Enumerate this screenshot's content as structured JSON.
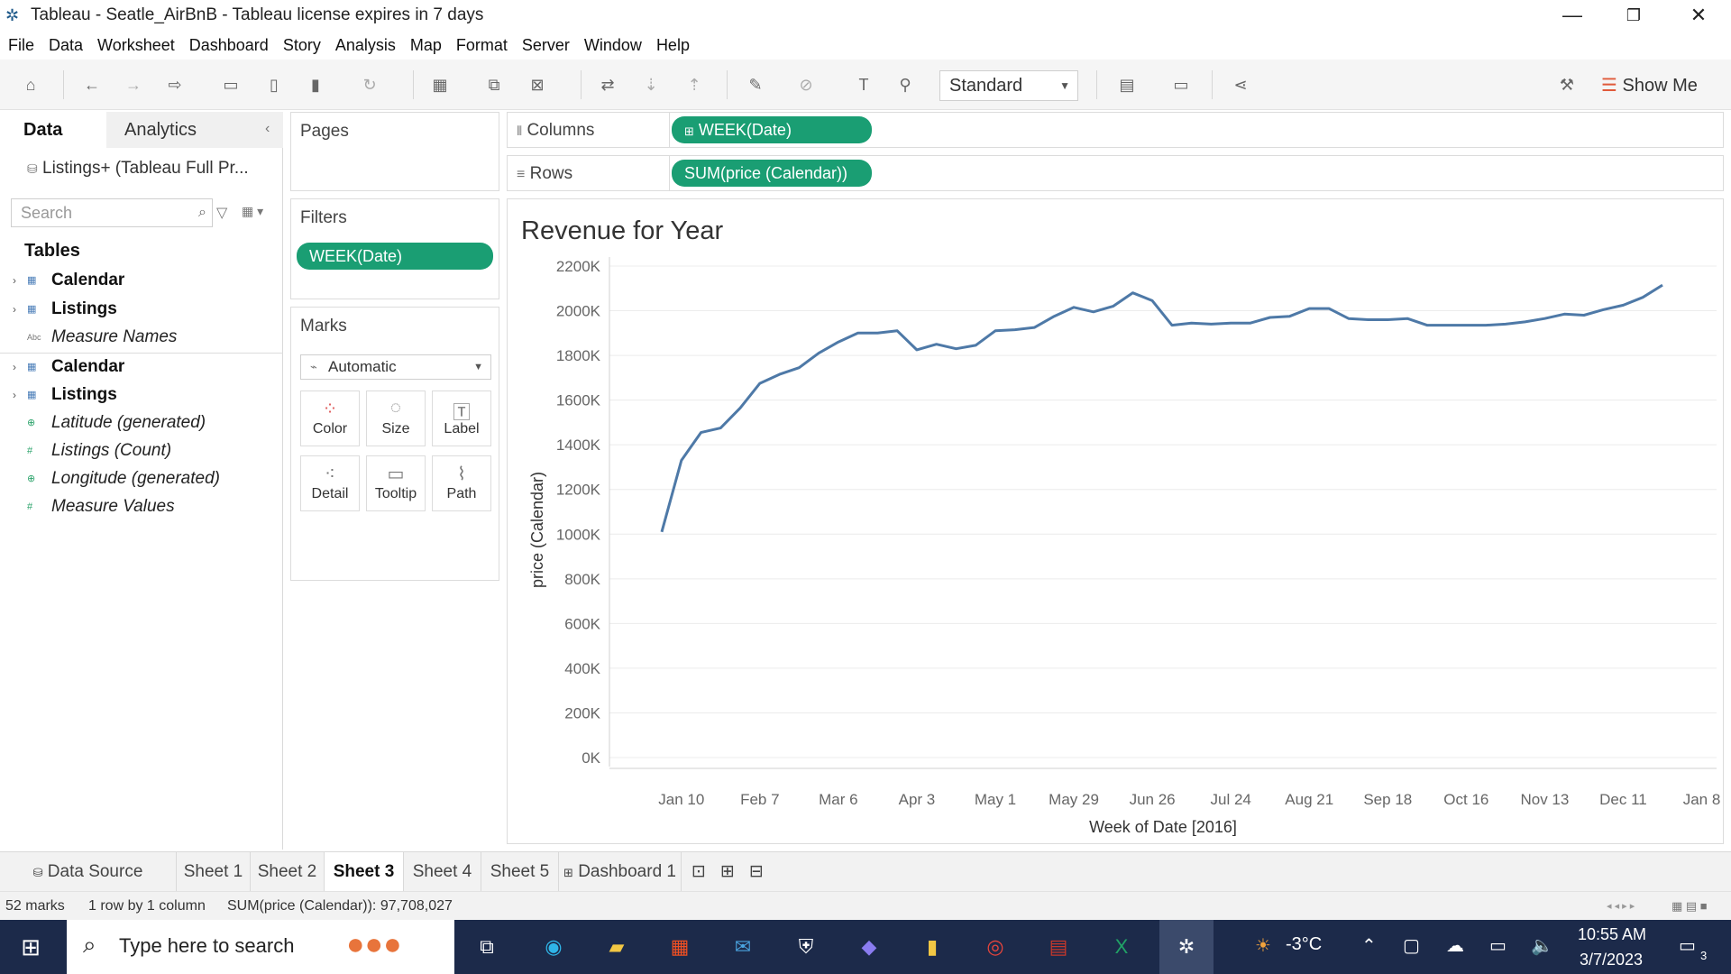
{
  "window": {
    "title": "Tableau - Seatle_AirBnB - Tableau license expires in 7 days",
    "icon": "tableau-logo-icon"
  },
  "menu": [
    "File",
    "Data",
    "Worksheet",
    "Dashboard",
    "Story",
    "Analysis",
    "Map",
    "Format",
    "Server",
    "Window",
    "Help"
  ],
  "toolbar": {
    "fit_select": "Standard",
    "show_me": "Show Me"
  },
  "data_pane": {
    "tab_data": "Data",
    "tab_analytics": "Analytics",
    "datasource": "Listings+ (Tableau Full Pr...",
    "search_placeholder": "Search",
    "tables_heading": "Tables",
    "fields": [
      {
        "label": "Calendar",
        "type": "table"
      },
      {
        "label": "Listings",
        "type": "table"
      },
      {
        "label": "Measure Names",
        "type": "abc"
      },
      {
        "label": "Calendar",
        "type": "table"
      },
      {
        "label": "Listings",
        "type": "table"
      },
      {
        "label": "Latitude (generated)",
        "type": "geo"
      },
      {
        "label": "Listings (Count)",
        "type": "measure"
      },
      {
        "label": "Longitude (generated)",
        "type": "geo"
      },
      {
        "label": "Measure Values",
        "type": "measure"
      }
    ]
  },
  "pages_card": {
    "title": "Pages"
  },
  "filters_card": {
    "title": "Filters",
    "pill": "WEEK(Date)"
  },
  "marks_card": {
    "title": "Marks",
    "type": "Automatic",
    "buttons": [
      "Color",
      "Size",
      "Label",
      "Detail",
      "Tooltip",
      "Path"
    ]
  },
  "shelves": {
    "columns_label": "Columns",
    "columns_pill": "WEEK(Date)",
    "rows_label": "Rows",
    "rows_pill": "SUM(price (Calendar))"
  },
  "viz": {
    "title": "Revenue for Year"
  },
  "chart_data": {
    "type": "line",
    "title": "Revenue for Year",
    "xlabel": "Week of Date [2016]",
    "ylabel": "price (Calendar)",
    "y_ticks": [
      "0K",
      "200K",
      "400K",
      "600K",
      "800K",
      "1000K",
      "1200K",
      "1400K",
      "1600K",
      "1800K",
      "2000K",
      "2200K"
    ],
    "x_ticks": [
      "Jan 10",
      "Feb 7",
      "Mar 6",
      "Apr 3",
      "May 1",
      "May 29",
      "Jun 26",
      "Jul 24",
      "Aug 21",
      "Sep 18",
      "Oct 16",
      "Nov 13",
      "Dec 11",
      "Jan 8"
    ],
    "ylim": [
      0,
      2200000
    ],
    "x": [
      "Jan 3",
      "Jan 10",
      "Jan 17",
      "Jan 24",
      "Jan 31",
      "Feb 7",
      "Feb 14",
      "Feb 21",
      "Feb 28",
      "Mar 6",
      "Mar 13",
      "Mar 20",
      "Mar 27",
      "Apr 3",
      "Apr 10",
      "Apr 17",
      "Apr 24",
      "May 1",
      "May 8",
      "May 15",
      "May 22",
      "May 29",
      "Jun 5",
      "Jun 12",
      "Jun 19",
      "Jun 26",
      "Jul 3",
      "Jul 10",
      "Jul 17",
      "Jul 24",
      "Jul 31",
      "Aug 7",
      "Aug 14",
      "Aug 21",
      "Aug 28",
      "Sep 4",
      "Sep 11",
      "Sep 18",
      "Sep 25",
      "Oct 2",
      "Oct 9",
      "Oct 16",
      "Oct 23",
      "Oct 30",
      "Nov 6",
      "Nov 13",
      "Nov 20",
      "Nov 27",
      "Dec 4",
      "Dec 11",
      "Dec 18",
      "Dec 25"
    ],
    "series": [
      {
        "values": [
          1010000,
          1330000,
          1455000,
          1475000,
          1565000,
          1675000,
          1715000,
          1745000,
          1810000,
          1860000,
          1900000,
          1900000,
          1910000,
          1825000,
          1850000,
          1830000,
          1845000,
          1910000,
          1915000,
          1925000,
          1975000,
          2015000,
          1995000,
          2020000,
          2080000,
          2045000,
          1935000,
          1945000,
          1940000,
          1945000,
          1945000,
          1970000,
          1975000,
          2010000,
          2010000,
          1965000,
          1960000,
          1960000,
          1965000,
          1935000,
          1935000,
          1935000,
          1935000,
          1940000,
          1950000,
          1965000,
          1985000,
          1980000,
          2005000,
          2025000,
          2060000,
          2115000
        ]
      }
    ]
  },
  "sheet_tabs": {
    "data_source": "Data Source",
    "sheets": [
      "Sheet 1",
      "Sheet 2",
      "Sheet 3",
      "Sheet 4",
      "Sheet 5",
      "Dashboard 1"
    ],
    "active": "Sheet 3"
  },
  "status": {
    "marks": "52 marks",
    "rows": "1 row by 1 column",
    "sum": "SUM(price (Calendar)): 97,708,027"
  },
  "taskbar": {
    "search_placeholder": "Type here to search",
    "weather": "-3°C",
    "time": "10:55 AM",
    "date": "3/7/2023",
    "notifications": "3"
  }
}
